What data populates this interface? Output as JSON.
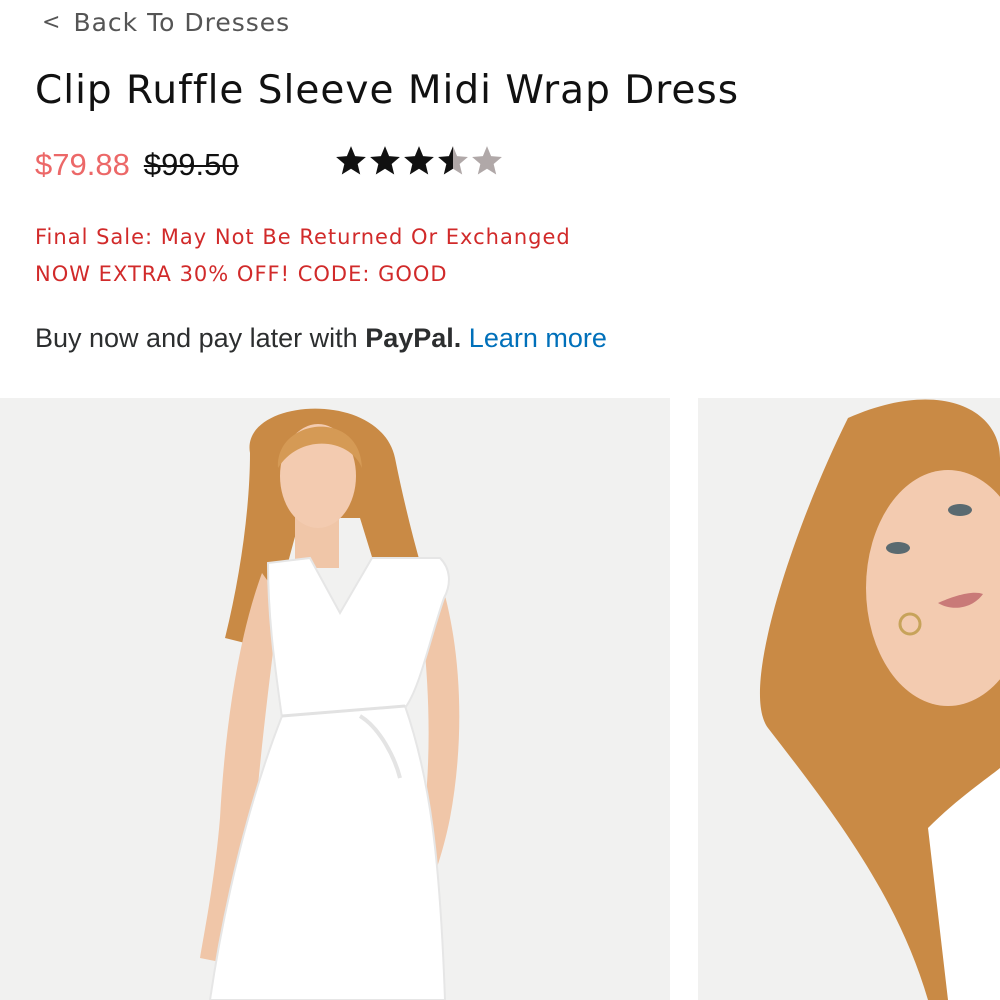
{
  "nav": {
    "back_chevron": "<",
    "back_label": "Back To Dresses"
  },
  "product": {
    "title": "Clip Ruffle Sleeve Midi Wrap Dress",
    "sale_price": "$79.88",
    "original_price": "$99.50",
    "rating": {
      "value": 3.5,
      "max": 5
    }
  },
  "promos": {
    "final_sale": "Final Sale: May Not Be Returned Or Exchanged",
    "extra_off": "NOW EXTRA 30% OFF! CODE: GOOD"
  },
  "paypal": {
    "prefix": "Buy now and pay later with",
    "brand": "PayPal.",
    "learn_more": "Learn more"
  },
  "gallery": {
    "photos": [
      {
        "name": "product-photo-front"
      },
      {
        "name": "product-photo-closeup"
      }
    ]
  },
  "colors": {
    "sale_price": "#ec6868",
    "promo_text": "#d12a2a",
    "paypal_link": "#0070ba",
    "star_filled": "#111111",
    "star_empty": "#b0a8a8"
  }
}
